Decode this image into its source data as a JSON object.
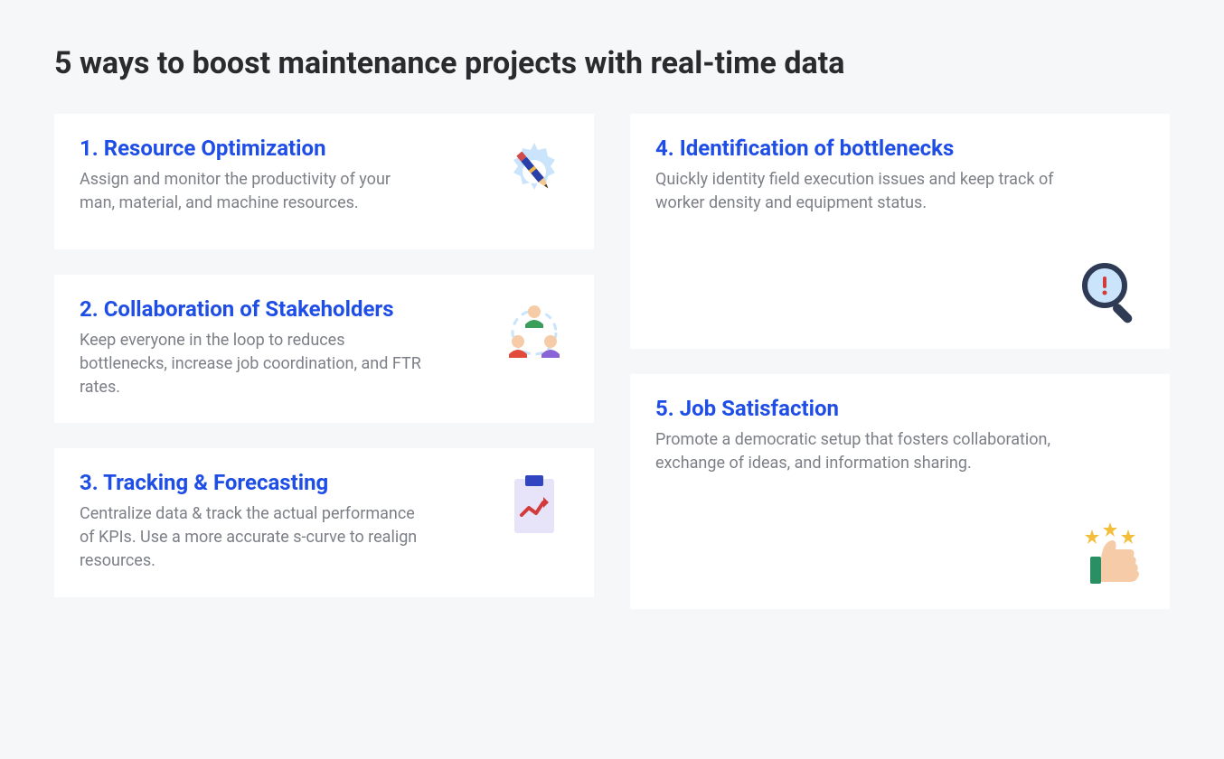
{
  "title": "5 ways to boost maintenance projects with real-time data",
  "cards": [
    {
      "heading": "1. Resource Optimization",
      "description": "Assign and monitor the productivity of your man, material, and machine resources."
    },
    {
      "heading": "2. Collaboration of Stakeholders",
      "description": "Keep everyone in the loop to reduces bottlenecks, increase job coordination, and FTR rates."
    },
    {
      "heading": "3. Tracking & Forecasting",
      "description": "Centralize data & track the actual performance of KPIs. Use a more accurate s-curve to realign resources."
    },
    {
      "heading": "4. Identification of bottlenecks",
      "description": "Quickly identity field execution issues and keep track of worker density and equipment status."
    },
    {
      "heading": "5. Job Satisfaction",
      "description": "Promote a democratic setup that fosters collaboration, exchange of ideas, and information sharing."
    }
  ]
}
